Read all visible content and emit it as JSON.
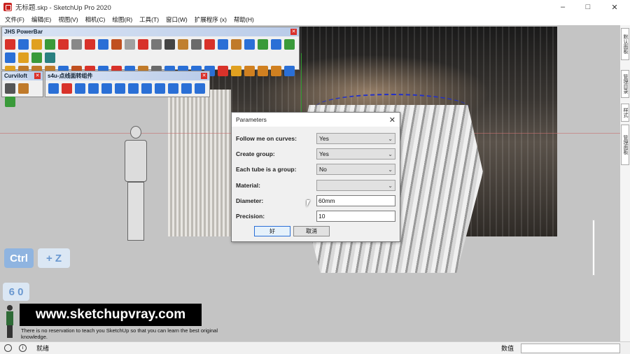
{
  "window": {
    "title": "无标题.skp - SketchUp Pro 2020",
    "minimize": "–",
    "maximize": "□",
    "close": "✕"
  },
  "menu": [
    "文件(F)",
    "编辑(E)",
    "视图(V)",
    "相机(C)",
    "绘图(R)",
    "工具(T)",
    "窗口(W)",
    "扩展程序 (x)",
    "帮助(H)"
  ],
  "toolbars": {
    "powerbar": {
      "title": "JHS PowerBar",
      "close": "✕"
    },
    "curviloft": {
      "title": "Curviloft",
      "close": "✕"
    },
    "s4u": {
      "title": "s4u-点线面转组件",
      "close": "✕"
    }
  },
  "icon_colors": {
    "powerbar_row1": [
      "#d8322a",
      "#2a6fd6",
      "#e0a020",
      "#3a9a3a",
      "#d8322a",
      "#888888",
      "#d8322a",
      "#2a6fd6",
      "#c05020",
      "#a0a0a0",
      "#d8322a",
      "#777777",
      "#444444",
      "#c08030",
      "#6a6a6a",
      "#d8322a",
      "#2a6fd6",
      "#c07a2a",
      "#2a6fd6",
      "#3a9a3a",
      "#2a6fd6",
      "#3a9a3a",
      "#2a6fd6",
      "#e0a020",
      "#3a9a3a",
      "#2a8080"
    ],
    "powerbar_row2": [
      "#e0a020",
      "#c07a2a",
      "#c07a2a",
      "#c07a2a",
      "#2a6fd6",
      "#c05020",
      "#d8322a",
      "#2a6fd6",
      "#d8322a",
      "#2a6fd6",
      "#c07a2a",
      "#6a6a6a",
      "#2a6fd6",
      "#2a6fd6",
      "#2a6fd6",
      "#2a6fd6",
      "#d8322a",
      "#e0a020",
      "#d08020",
      "#d08020",
      "#d08020",
      "#2a6fd6",
      "#777777",
      "#444444",
      "#2a6fd6",
      "#888888"
    ],
    "curviloft": [
      "#555555",
      "#c07a2a",
      "#3a9a3a"
    ],
    "s4u": [
      "#2a6fd6",
      "#d8322a",
      "#2a6fd6",
      "#2a6fd6",
      "#2a6fd6",
      "#2a6fd6",
      "#2a6fd6",
      "#2a6fd6",
      "#2a6fd6",
      "#2a6fd6",
      "#2a6fd6",
      "#2a6fd6"
    ]
  },
  "dialog": {
    "title": "Parameters",
    "close": "✕",
    "fields": {
      "follow_label": "Follow me on curves:",
      "follow_value": "Yes",
      "group_label": "Create group:",
      "group_value": "Yes",
      "tube_label": "Each tube is a group:",
      "tube_value": "No",
      "material_label": "Material:",
      "material_value": "",
      "diameter_label": "Diameter:",
      "diameter_value": "60mm",
      "precision_label": "Precision:",
      "precision_value": "10"
    },
    "ok": "好",
    "cancel": "取消"
  },
  "overlay": {
    "ctrl": "Ctrl",
    "plus_z": "+ Z",
    "sixty": "6 0",
    "site": "www.sketchupvray.com",
    "tagline": "There is no reservation to teach you SketchUp so that you can learn the best original knowledge."
  },
  "side_tabs": [
    "默认面板",
    "管理目录",
    "样式",
    "管理面板"
  ],
  "status": {
    "text": "就绪",
    "measure_label": "数值",
    "measure_value": ""
  },
  "colors": {
    "accent_blue": "#2a6fd6",
    "brand_red": "#c9211e"
  }
}
